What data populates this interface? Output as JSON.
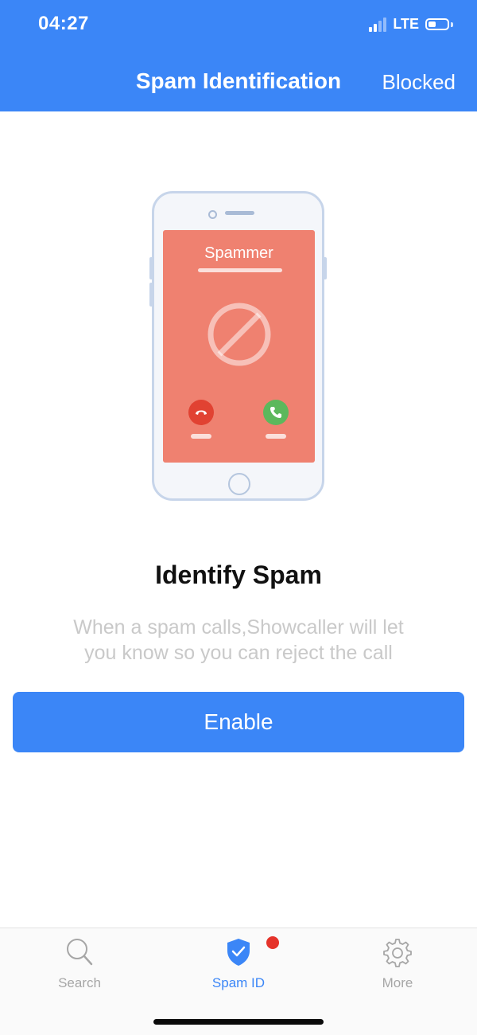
{
  "status_bar": {
    "time": "04:27",
    "network": "LTE"
  },
  "header": {
    "title": "Spam Identification",
    "action": "Blocked"
  },
  "illustration": {
    "caller_label": "Spammer"
  },
  "main": {
    "title": "Identify Spam",
    "description": "When a spam calls,Showcaller will let you know so you can reject the call",
    "button_label": "Enable"
  },
  "tabs": [
    {
      "label": "Search",
      "icon": "search-icon",
      "active": false
    },
    {
      "label": "Spam ID",
      "icon": "shield-check-icon",
      "active": true,
      "badge": true
    },
    {
      "label": "More",
      "icon": "gear-icon",
      "active": false
    }
  ],
  "colors": {
    "primary": "#3b86f7",
    "spam_screen": "#ef8170",
    "decline": "#e14232",
    "accept": "#5cb85c",
    "badge": "#e5332a"
  }
}
